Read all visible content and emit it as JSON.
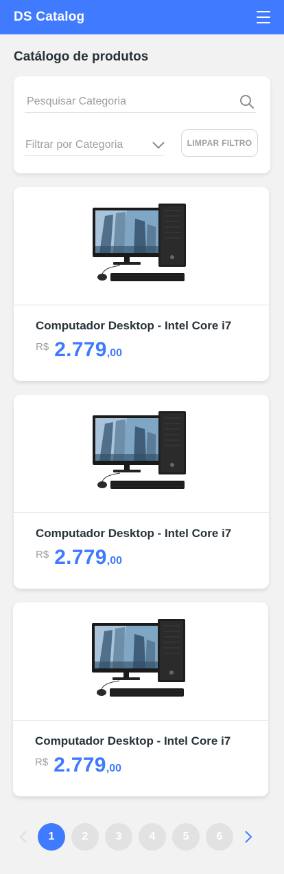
{
  "navbar": {
    "brand": "DS Catalog",
    "menu_icon": "hamburger-menu-icon"
  },
  "page": {
    "title": "Catálogo de produtos"
  },
  "filter": {
    "search_placeholder": "Pesquisar Categoria",
    "search_icon": "search-icon",
    "category_placeholder": "Filtrar por Categoria",
    "category_icon": "chevron-down-icon",
    "clear_label": "LIMPAR FILTRO"
  },
  "products": [
    {
      "name": "Computador Desktop - Intel Core i7",
      "currency": "R$",
      "price_int": "2.779",
      "price_dec": ",00"
    },
    {
      "name": "Computador Desktop - Intel Core i7",
      "currency": "R$",
      "price_int": "2.779",
      "price_dec": ",00"
    },
    {
      "name": "Computador Desktop - Intel Core i7",
      "currency": "R$",
      "price_int": "2.779",
      "price_dec": ",00"
    }
  ],
  "pagination": {
    "prev_icon": "chevron-left-icon",
    "next_icon": "chevron-right-icon",
    "pages": [
      "1",
      "2",
      "3",
      "4",
      "5",
      "6"
    ],
    "active_page": "1"
  },
  "colors": {
    "primary": "#407bff",
    "background": "#f2f2f2",
    "text": "#263238",
    "muted": "#9e9e9e"
  }
}
